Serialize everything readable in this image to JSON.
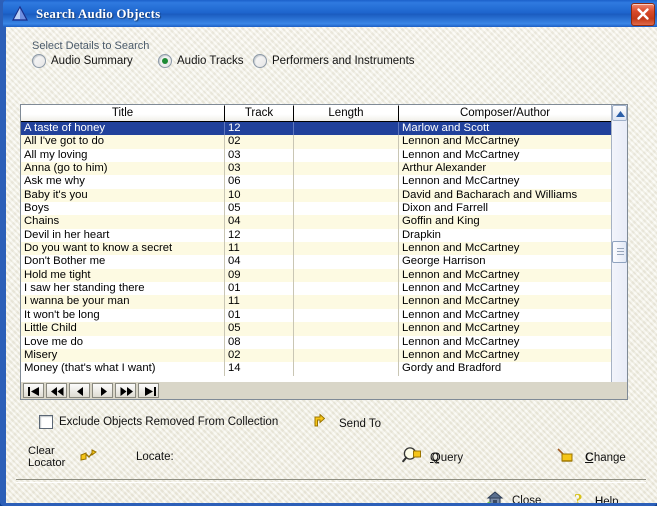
{
  "window": {
    "title": "Search Audio Objects",
    "icon": "triangle-icon",
    "close_icon": "close-icon",
    "titlebar_color": "#1d64cc",
    "frame_color": "#2c5fb8",
    "client_bg": "#ecead9"
  },
  "search_options": {
    "group_label": "Select Details to Search",
    "selected": "Audio Tracks",
    "items": [
      {
        "label": "Audio Summary",
        "selected": false
      },
      {
        "label": "Audio Tracks",
        "selected": true
      },
      {
        "label": "Performers and Instruments",
        "selected": false
      }
    ],
    "selected_dot_color": "#1d8a34"
  },
  "grid": {
    "columns": [
      "Title",
      "Track",
      "Length",
      "Composer/Author"
    ],
    "selected_row_index": 0,
    "selection_color": "#21419b",
    "alt_row_color": "#fdfae2",
    "rows": [
      {
        "title": "A taste of honey",
        "track": "12",
        "length": "",
        "composer": "Marlow and Scott"
      },
      {
        "title": "All I've got to do",
        "track": "02",
        "length": "",
        "composer": "Lennon and McCartney"
      },
      {
        "title": "All my loving",
        "track": "03",
        "length": "",
        "composer": "Lennon and McCartney"
      },
      {
        "title": "Anna (go to him)",
        "track": "03",
        "length": "",
        "composer": "Arthur Alexander"
      },
      {
        "title": "Ask me why",
        "track": "06",
        "length": "",
        "composer": "Lennon and McCartney"
      },
      {
        "title": "Baby it's you",
        "track": "10",
        "length": "",
        "composer": "David and Bacharach and Williams"
      },
      {
        "title": "Boys",
        "track": "05",
        "length": "",
        "composer": "Dixon and Farrell"
      },
      {
        "title": "Chains",
        "track": "04",
        "length": "",
        "composer": "Goffin and King"
      },
      {
        "title": "Devil in her heart",
        "track": "12",
        "length": "",
        "composer": "Drapkin"
      },
      {
        "title": "Do you want to know a secret",
        "track": "11",
        "length": "",
        "composer": "Lennon and McCartney"
      },
      {
        "title": "Don't Bother me",
        "track": "04",
        "length": "",
        "composer": "George Harrison"
      },
      {
        "title": "Hold me tight",
        "track": "09",
        "length": "",
        "composer": "Lennon and McCartney"
      },
      {
        "title": "I saw her standing there",
        "track": "01",
        "length": "",
        "composer": "Lennon and McCartney"
      },
      {
        "title": "I wanna be your man",
        "track": "11",
        "length": "",
        "composer": "Lennon and McCartney"
      },
      {
        "title": "It won't be long",
        "track": "01",
        "length": "",
        "composer": "Lennon and McCartney"
      },
      {
        "title": "Little Child",
        "track": "05",
        "length": "",
        "composer": "Lennon and McCartney"
      },
      {
        "title": "Love me do",
        "track": "08",
        "length": "",
        "composer": "Lennon and McCartney"
      },
      {
        "title": "Misery",
        "track": "02",
        "length": "",
        "composer": "Lennon and McCartney"
      },
      {
        "title": "Money (that's what I want)",
        "track": "14",
        "length": "",
        "composer": "Gordy and Bradford"
      }
    ]
  },
  "nav": {
    "buttons": [
      {
        "name": "first",
        "glyph": "first-record-icon"
      },
      {
        "name": "rewind",
        "glyph": "prev-page-icon"
      },
      {
        "name": "previous",
        "glyph": "prev-record-icon"
      },
      {
        "name": "next",
        "glyph": "next-record-icon"
      },
      {
        "name": "forward",
        "glyph": "next-page-icon"
      },
      {
        "name": "last",
        "glyph": "last-record-icon"
      }
    ]
  },
  "bottom": {
    "exclude_checkbox_label": "Exclude Objects Removed From Collection",
    "exclude_checked": false,
    "send_to_label": "Send To",
    "send_to_icon": "yellow-arrow-icon",
    "clear_locator_line1": "Clear",
    "clear_locator_line2": "Locator",
    "clear_locator_icon": "eraser-arrow-icon",
    "locate_label": "Locate:",
    "query_label": "Query",
    "query_accel": "Q",
    "query_icon": "magnifier-icon",
    "change_label": "Change",
    "change_accel": "C",
    "change_icon": "pencil-folder-icon",
    "close_label": "Close",
    "close_accel": "l",
    "close_icon": "house-icon",
    "help_label": "Help",
    "help_accel": "H",
    "help_icon": "question-mark-icon"
  }
}
